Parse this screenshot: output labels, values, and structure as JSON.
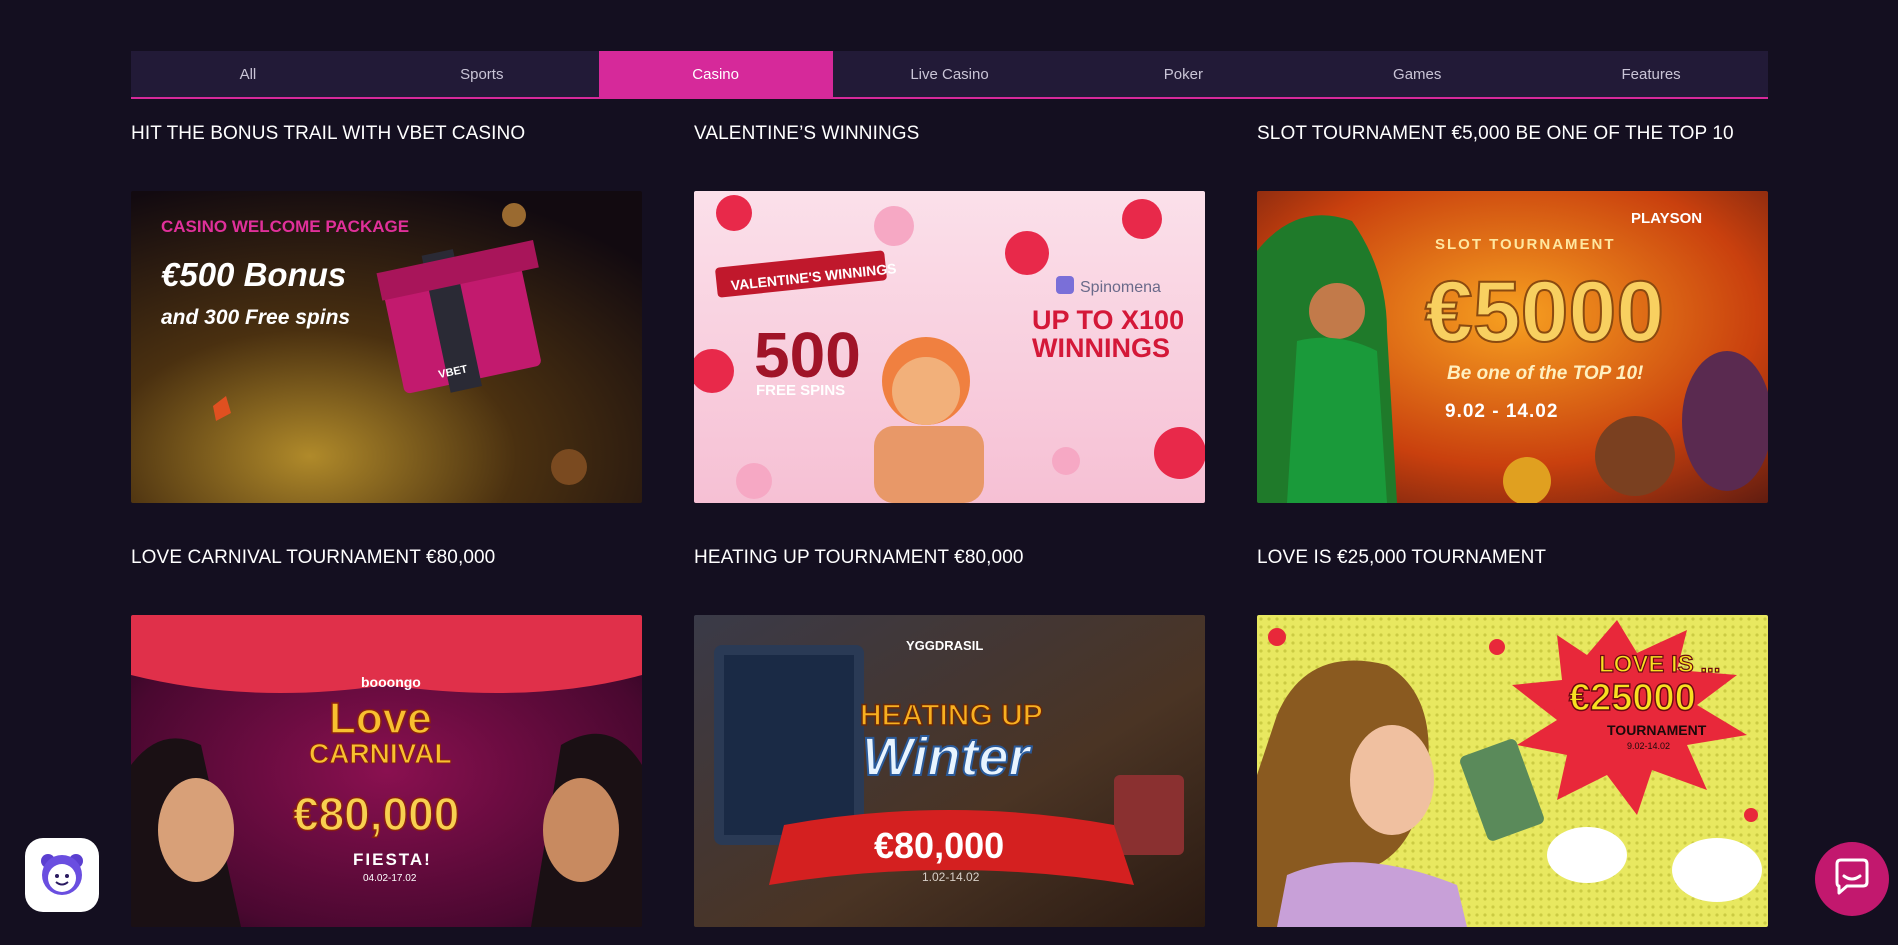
{
  "tabs": [
    {
      "label": "All",
      "active": false
    },
    {
      "label": "Sports",
      "active": false
    },
    {
      "label": "Casino",
      "active": true
    },
    {
      "label": "Live Casino",
      "active": false
    },
    {
      "label": "Poker",
      "active": false
    },
    {
      "label": "Games",
      "active": false
    },
    {
      "label": "Features",
      "active": false
    }
  ],
  "promos": [
    {
      "title": "HIT THE BONUS TRAIL WITH VBET CASINO",
      "banner": {
        "kicker": "CASINO WELCOME PACKAGE",
        "headline": "€500 Bonus",
        "sub": "and 300 Free spins",
        "brand": "VBET"
      }
    },
    {
      "title": "VALENTINE’S WINNINGS",
      "banner": {
        "ribbon": "VALENTINE'S WINNINGS",
        "big": "500",
        "sub": "FREE SPINS",
        "provider": "Spinomena",
        "line1": "UP TO X100",
        "line2": "WINNINGS"
      }
    },
    {
      "title": "SLOT TOURNAMENT €5,000 BE ONE OF THE TOP 10",
      "banner": {
        "provider": "PLAYSON",
        "kicker": "SLOT TOURNAMENT",
        "big": "€5000",
        "sub": "Be one of the TOP 10!",
        "dates": "9.02 - 14.02"
      }
    },
    {
      "title": "LOVE CARNIVAL TOURNAMENT €80,000",
      "banner": {
        "provider": "booongo",
        "line1": "Love",
        "line2": "CARNIVAL",
        "big": "€80,000",
        "sub": "FIESTA!",
        "dates": "04.02-17.02"
      }
    },
    {
      "title": "HEATING UP TOURNAMENT €80,000",
      "banner": {
        "provider": "YGGDRASIL",
        "line1": "HEATING UP",
        "line2": "Winter",
        "big": "€80,000",
        "dates": "1.02-14.02"
      }
    },
    {
      "title": "LOVE IS €25,000 TOURNAMENT",
      "banner": {
        "line1": "LOVE IS ...",
        "big": "€25000",
        "sub": "TOURNAMENT",
        "dates": "9.02-14.02"
      }
    }
  ],
  "colors": {
    "background": "#140f20",
    "tab_bar": "#221a37",
    "accent": "#d6299a",
    "chat_button": "#c2186e"
  },
  "icons": {
    "helper": "assistant-avatar-icon",
    "chat": "chat-bubble-icon"
  }
}
